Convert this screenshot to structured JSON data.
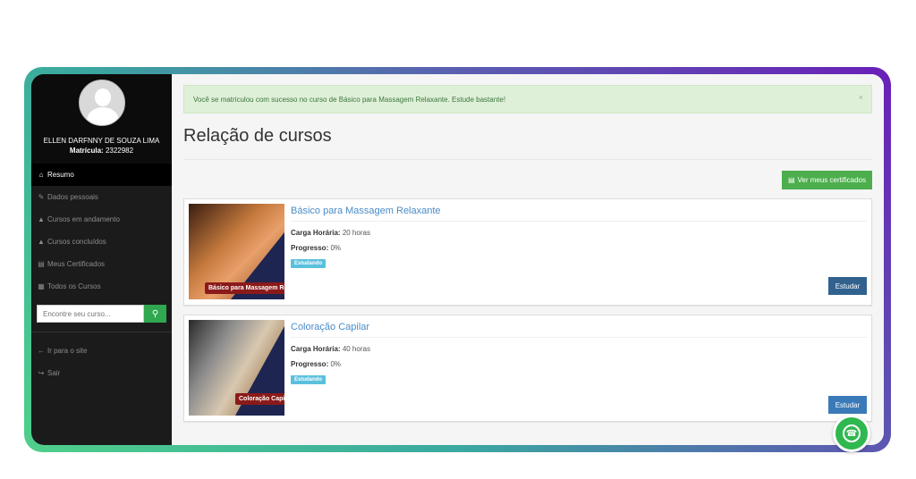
{
  "profile": {
    "name": "ELLEN DARFNNY DE SOUZA LIMA",
    "matricula_label": "Matrícula:",
    "matricula_value": "2322982"
  },
  "sidebar": {
    "items": [
      {
        "label": "Resumo",
        "icon": "home-icon"
      },
      {
        "label": "Dados pessoais",
        "icon": "pencil-icon"
      },
      {
        "label": "Cursos em andamento",
        "icon": "graduation-cap-icon"
      },
      {
        "label": "Cursos concluídos",
        "icon": "graduation-cap-icon"
      },
      {
        "label": "Meus Certificados",
        "icon": "inbox-icon"
      },
      {
        "label": "Todos os Cursos",
        "icon": "grid-icon"
      }
    ],
    "search_placeholder": "Encontre seu curso...",
    "bottom_items": [
      {
        "label": "Ir para o site",
        "icon": "arrow-left-icon"
      },
      {
        "label": "Sair",
        "icon": "sign-out-icon"
      }
    ]
  },
  "alert": {
    "message": "Você se matriculou com sucesso no curso de Básico para Massagem Relaxante. Estude bastante!",
    "close": "×"
  },
  "page_title": "Relação de cursos",
  "cert_button": "Ver meus certificados",
  "courses": [
    {
      "title": "Básico para Massagem Relaxante",
      "thumb_label": "Básico para Massagem Relaxante",
      "carga_label": "Carga Horária:",
      "carga_value": "20 horas",
      "progresso_label": "Progresso:",
      "progresso_value": "0%",
      "progress": 0,
      "badge": "Estudando",
      "button": "Estudar"
    },
    {
      "title": "Coloração Capilar",
      "thumb_label": "Coloração Capilar",
      "carga_label": "Carga Horária:",
      "carga_value": "40 horas",
      "progresso_label": "Progresso:",
      "progresso_value": "0%",
      "progress": 0,
      "badge": "Estudando",
      "button": "Estudar"
    }
  ],
  "colors": {
    "sidebar": "#1b1b1b",
    "accent_green": "#4cae4c",
    "study_button": "#31618f",
    "badge": "#5bc0de",
    "link": "#4a8cc8"
  }
}
